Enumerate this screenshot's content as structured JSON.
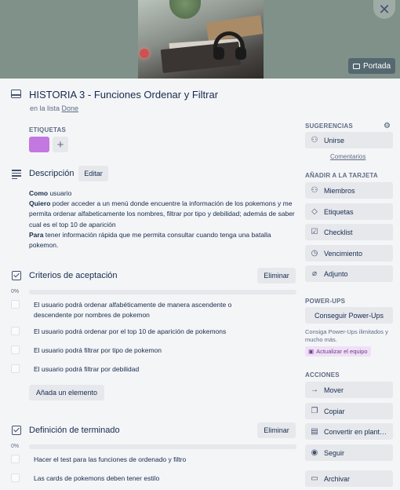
{
  "header": {
    "cover_button": "Portada",
    "title": "HISTORIA 3 - Funciones Ordenar y Filtrar",
    "in_list_prefix": "en la lista",
    "list_name": "Done"
  },
  "labels": {
    "heading": "ETIQUETAS",
    "colors": [
      "#c377e0"
    ],
    "add": "+"
  },
  "description": {
    "title": "Descripción",
    "edit_button": "Editar",
    "como_label": "Como",
    "como_text": " usuario",
    "quiero_label": "Quiero",
    "quiero_text": " poder acceder a un menú donde encuentre la información de los pokemons y me permita ordenar alfabeticamente los nombres, filtrar por tipo y debilidad; además de saber cual es el top 10 de aparición",
    "para_label": "Para",
    "para_text": " tener información rápida que me permita consultar cuando tenga una batalla pokemon."
  },
  "checklists": [
    {
      "title": "Criterios de aceptación",
      "delete_button": "Eliminar",
      "progress": "0%",
      "progress_value": 0,
      "items": [
        "El usuario podrá ordenar alfabéticamente de manera ascendente o descendente por nombres de pokemon",
        "El usuario podrá ordenar por el top 10 de aparición de pokemons",
        "El usuario podrá filtrar por tipo de pokemon",
        "El usuario podrá filtrar por debilidad"
      ],
      "add_item_button": "Añada un elemento"
    },
    {
      "title": "Definición de terminado",
      "delete_button": "Eliminar",
      "progress": "0%",
      "progress_value": 0,
      "items": [
        "Hacer el test para las funciones de ordenado y filtro",
        "Las cards de pokemons deben tener estilo"
      ]
    }
  ],
  "sidebar": {
    "suggestions_heading": "SUGERENCIAS",
    "join_button": "Unirse",
    "comments_link": "Comentarios",
    "add_to_card_heading": "AÑADIR A LA TARJETA",
    "add_buttons": [
      "Miembros",
      "Etiquetas",
      "Checklist",
      "Vencimiento",
      "Adjunto"
    ],
    "powerups_heading": "POWER-UPS",
    "powerups_button": "Conseguir Power-Ups",
    "powerups_note": "Consiga Power-Ups ilimitados y mucho más.",
    "team_badge": "Actualizar el equipo",
    "actions_heading": "ACCIONES",
    "action_buttons": [
      "Mover",
      "Copiar",
      "Convertir en plant…",
      "Seguir",
      "Archivar"
    ]
  },
  "colors": {
    "label_purple": "#c377e0",
    "background": "#f4f5f7",
    "button_gray": "#e6e8ec"
  }
}
